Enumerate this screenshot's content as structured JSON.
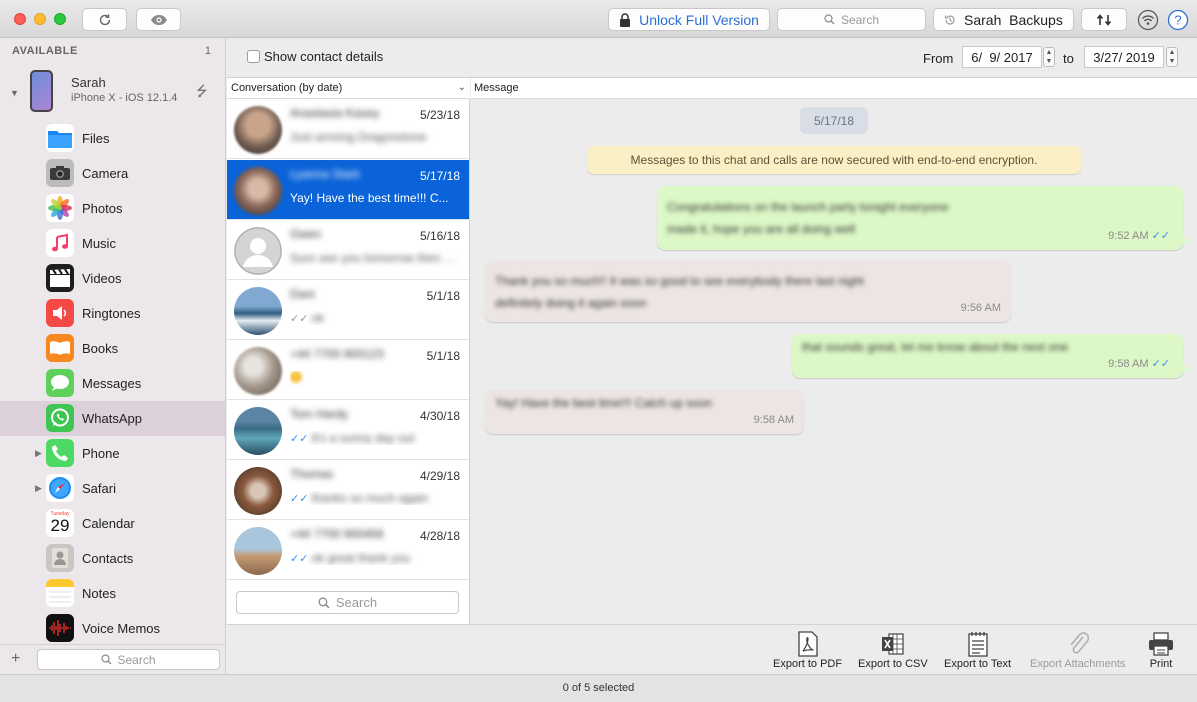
{
  "toolbar": {
    "unlock_label": "Unlock Full Version",
    "search_placeholder": "Search",
    "backups_label": "Sarah  Backups"
  },
  "sidebar": {
    "header": "AVAILABLE",
    "count": "1",
    "device": {
      "name": "Sarah",
      "model": "iPhone X - iOS 12.1.4"
    },
    "items": [
      {
        "label": "Files",
        "icon": "files-icon"
      },
      {
        "label": "Camera",
        "icon": "camera-icon"
      },
      {
        "label": "Photos",
        "icon": "photos-icon"
      },
      {
        "label": "Music",
        "icon": "music-icon"
      },
      {
        "label": "Videos",
        "icon": "videos-icon"
      },
      {
        "label": "Ringtones",
        "icon": "ringtones-icon"
      },
      {
        "label": "Books",
        "icon": "books-icon"
      },
      {
        "label": "Messages",
        "icon": "messages-icon"
      },
      {
        "label": "WhatsApp",
        "icon": "whatsapp-icon",
        "selected": true
      },
      {
        "label": "Phone",
        "icon": "phone-icon"
      },
      {
        "label": "Safari",
        "icon": "safari-icon"
      },
      {
        "label": "Calendar",
        "icon": "calendar-icon",
        "calendar_day_name": "Tuesday",
        "calendar_day": "29"
      },
      {
        "label": "Contacts",
        "icon": "contacts-icon"
      },
      {
        "label": "Notes",
        "icon": "notes-icon"
      },
      {
        "label": "Voice Memos",
        "icon": "voice-memos-icon"
      }
    ],
    "search_placeholder": "Search"
  },
  "filter": {
    "show_contact_details": "Show contact details",
    "from_label": "From",
    "from_date": "6/  9/ 2017",
    "to_label": "to",
    "to_date": "3/27/ 2019"
  },
  "conversations": {
    "column_header": "Conversation (by date)",
    "items": [
      {
        "name": "Anastasia Kasey",
        "date": "5/23/18",
        "preview": "Just arriving Dragonstone",
        "blurred": true
      },
      {
        "name": "Lyanna Stark",
        "date": "5/17/18",
        "preview": "Yay! Have the best time!!! C...",
        "blurred": false,
        "selected": true
      },
      {
        "name": "Gwen",
        "date": "5/16/18",
        "preview": "Sure see you tomorrow then bye",
        "blurred": true
      },
      {
        "name": "Dani",
        "date": "5/1/18",
        "preview": "ok",
        "blurred": true,
        "ticks": "gray"
      },
      {
        "name": "+44 7700 900123",
        "date": "5/1/18",
        "preview": "",
        "blurred": true
      },
      {
        "name": "Tom Hardy",
        "date": "4/30/18",
        "preview": "It's a sunny day out",
        "blurred": true,
        "ticks": "blue"
      },
      {
        "name": "Thomas",
        "date": "4/29/18",
        "preview": "thanks so much again",
        "blurred": true,
        "ticks": "blue"
      },
      {
        "name": "+44 7700 900456",
        "date": "4/28/18",
        "preview": "ok great thank you",
        "blurred": true,
        "ticks": "blue"
      }
    ],
    "search_placeholder": "Search"
  },
  "messages": {
    "column_header": "Message",
    "date_pill": "5/17/18",
    "system_message": "Messages to this chat and calls are now secured with end-to-end encryption.",
    "items": [
      {
        "direction": "out",
        "text_line1": "Congratulations on the launch party tonight everyone",
        "text_line2": "made it, hope you are all doing well",
        "time": "9:52 AM"
      },
      {
        "direction": "in",
        "text_line1": "Thank you so much!! It was so good to see everybody there last night",
        "text_line2": "definitely doing it again soon",
        "time": "9:56 AM"
      },
      {
        "direction": "out",
        "text_line1": "that sounds great, let me know about the next one",
        "text_line2": "",
        "time": "9:58 AM"
      },
      {
        "direction": "in",
        "text_line1": "Yay! Have the best time!!! Catch up soon",
        "text_line2": "",
        "time": "9:58 AM"
      }
    ]
  },
  "export": {
    "pdf": "Export to PDF",
    "csv": "Export to CSV",
    "text": "Export to Text",
    "attachments": "Export Attachments",
    "print": "Print"
  },
  "status": {
    "selection": "0 of 5 selected"
  },
  "colors": {
    "accent": "#0a63d8",
    "bubble_out": "#dcf8c6",
    "bubble_in": "#ece5e3",
    "system_bg": "#fbefc5"
  }
}
